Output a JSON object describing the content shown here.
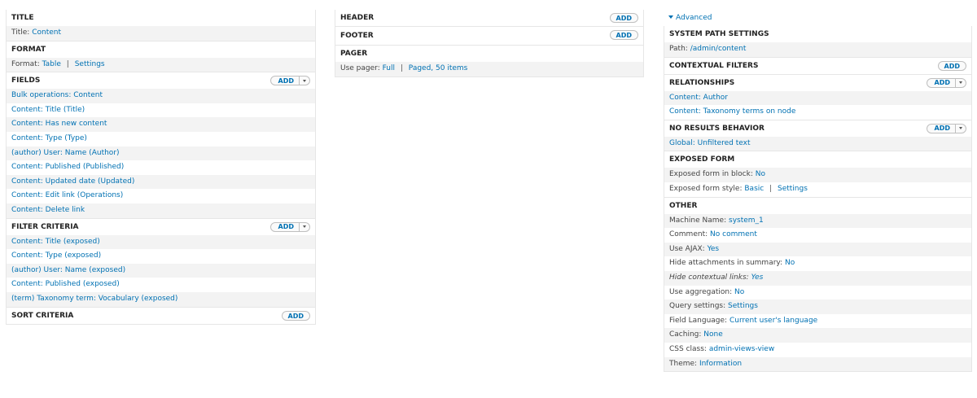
{
  "col1": {
    "title_section": {
      "heading": "TITLE",
      "label": "Title:",
      "value": "Content"
    },
    "format_section": {
      "heading": "FORMAT",
      "label": "Format:",
      "value": "Table",
      "separator": "|",
      "settings": "Settings"
    },
    "fields_section": {
      "heading": "FIELDS",
      "add_label": "Add",
      "items": [
        "Bulk operations: Content",
        "Content: Title (Title)",
        "Content: Has new content",
        "Content: Type (Type)",
        "(author) User: Name (Author)",
        "Content: Published (Published)",
        "Content: Updated date (Updated)",
        "Content: Edit link (Operations)",
        "Content: Delete link"
      ]
    },
    "filter_section": {
      "heading": "FILTER CRITERIA",
      "add_label": "Add",
      "items": [
        "Content: Title (exposed)",
        "Content: Type (exposed)",
        "(author) User: Name (exposed)",
        "Content: Published (exposed)",
        "(term) Taxonomy term: Vocabulary (exposed)"
      ]
    },
    "sort_section": {
      "heading": "SORT CRITERIA",
      "add_label": "Add"
    }
  },
  "col2": {
    "header_section": {
      "heading": "HEADER",
      "add_label": "Add"
    },
    "footer_section": {
      "heading": "FOOTER",
      "add_label": "Add"
    },
    "pager_section": {
      "heading": "PAGER",
      "label": "Use pager:",
      "value": "Full",
      "separator": "|",
      "settings": "Paged, 50 items"
    }
  },
  "col3": {
    "advanced_label": "Advanced",
    "system_path": {
      "heading": "SYSTEM PATH SETTINGS",
      "label": "Path:",
      "value": "/admin/content"
    },
    "contextual_filters": {
      "heading": "CONTEXTUAL FILTERS",
      "add_label": "Add"
    },
    "relationships": {
      "heading": "RELATIONSHIPS",
      "add_label": "Add",
      "items": [
        "Content: Author",
        "Content: Taxonomy terms on node"
      ]
    },
    "no_results": {
      "heading": "NO RESULTS BEHAVIOR",
      "add_label": "Add",
      "items": [
        "Global: Unfiltered text"
      ]
    },
    "exposed_form": {
      "heading": "EXPOSED FORM",
      "in_block_label": "Exposed form in block:",
      "in_block_value": "No",
      "style_label": "Exposed form style:",
      "style_value": "Basic",
      "separator": "|",
      "style_settings": "Settings"
    },
    "other": {
      "heading": "OTHER",
      "rows": [
        {
          "label": "Machine Name:",
          "value": "system_1"
        },
        {
          "label": "Comment:",
          "value": "No comment"
        },
        {
          "label": "Use AJAX:",
          "value": "Yes"
        },
        {
          "label": "Hide attachments in summary:",
          "value": "No"
        },
        {
          "label": "Hide contextual links:",
          "value": "Yes"
        },
        {
          "label": "Use aggregation:",
          "value": "No"
        },
        {
          "label": "Query settings:",
          "value": "Settings"
        },
        {
          "label": "Field Language:",
          "value": "Current user's language"
        },
        {
          "label": "Caching:",
          "value": "None"
        },
        {
          "label": "CSS class:",
          "value": "admin-views-view"
        },
        {
          "label": "Theme:",
          "value": "Information"
        }
      ]
    }
  },
  "colors": {
    "link": "#0071b3",
    "row_alt": "#f3f3f3",
    "border": "#e6e6e6"
  }
}
